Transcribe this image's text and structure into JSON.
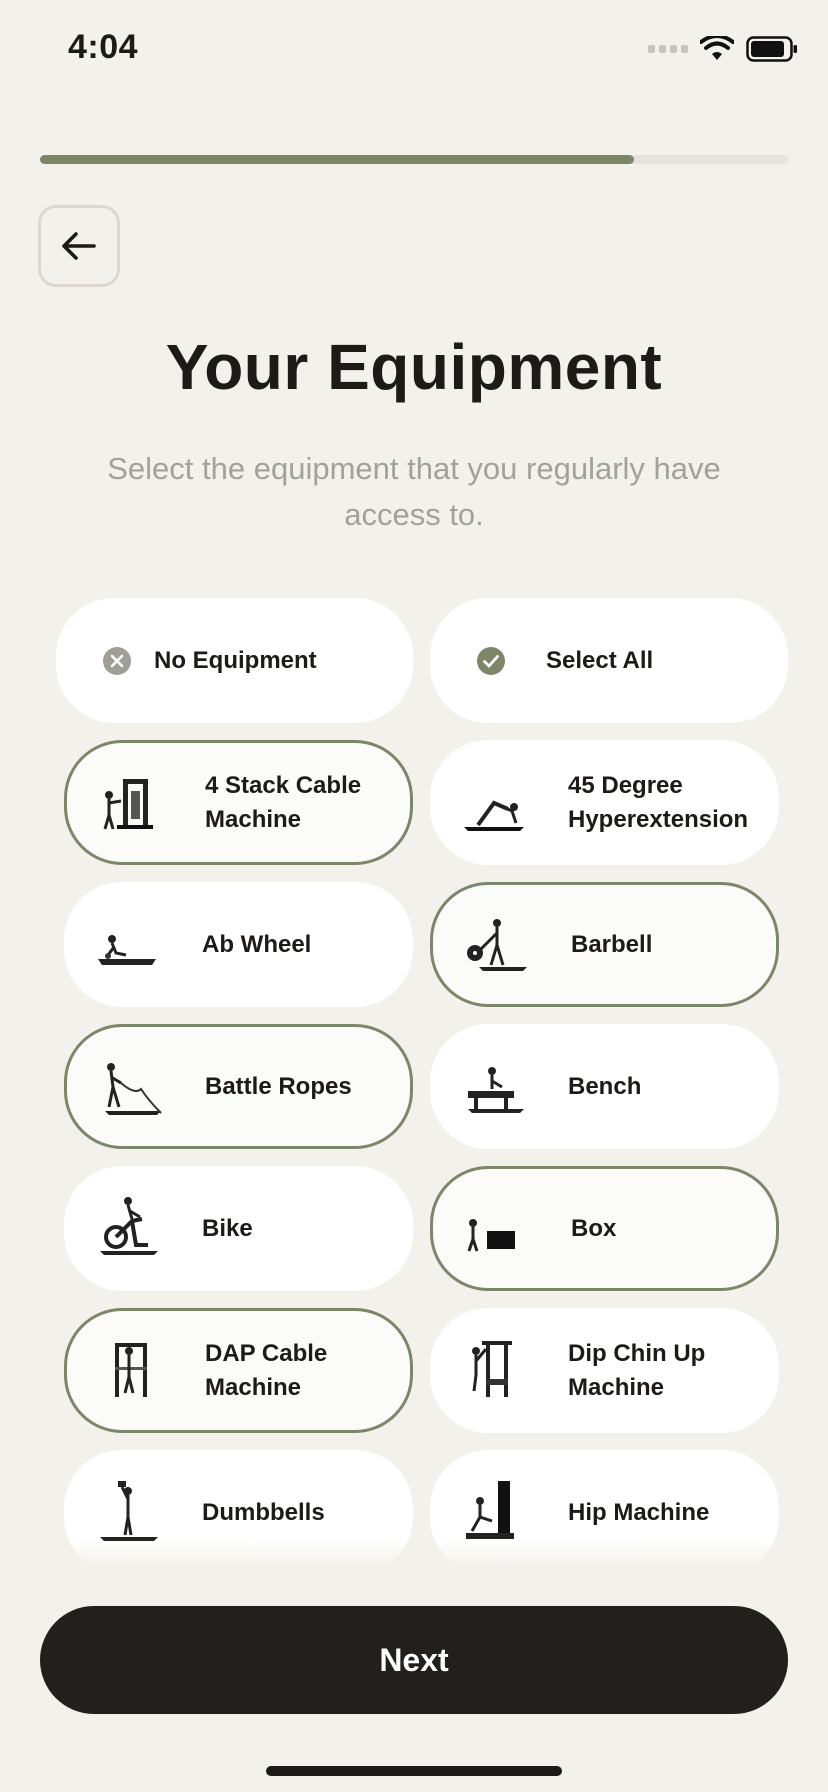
{
  "status_bar": {
    "time": "4:04"
  },
  "progress": {
    "fraction": 0.794
  },
  "page": {
    "title": "Your Equipment",
    "subtitle": "Select the equipment that you regularly have access to."
  },
  "quick_options": [
    {
      "label": "No Equipment",
      "icon": "x-circle-icon"
    },
    {
      "label": "Select All",
      "icon": "check-circle-icon"
    }
  ],
  "equipment": [
    {
      "label": "4 Stack Cable Machine",
      "selected": true,
      "icon": "cable-machine-icon"
    },
    {
      "label": "45 Degree Hyperextension",
      "selected": false,
      "icon": "hyperextension-icon"
    },
    {
      "label": "Ab Wheel",
      "selected": false,
      "icon": "ab-wheel-icon"
    },
    {
      "label": "Barbell",
      "selected": true,
      "icon": "barbell-icon"
    },
    {
      "label": "Battle Ropes",
      "selected": true,
      "icon": "battle-ropes-icon"
    },
    {
      "label": "Bench",
      "selected": false,
      "icon": "bench-icon"
    },
    {
      "label": "Bike",
      "selected": false,
      "icon": "bike-icon"
    },
    {
      "label": "Box",
      "selected": true,
      "icon": "box-icon"
    },
    {
      "label": "DAP Cable Machine",
      "selected": true,
      "icon": "dap-cable-machine-icon"
    },
    {
      "label": "Dip Chin Up Machine",
      "selected": false,
      "icon": "dip-chin-up-icon"
    },
    {
      "label": "Dumbbells",
      "selected": false,
      "icon": "dumbbells-icon"
    },
    {
      "label": "Hip Machine",
      "selected": false,
      "icon": "hip-machine-icon"
    }
  ],
  "footer": {
    "next_label": "Next"
  },
  "colors": {
    "accent": "#7c8669",
    "background": "#f3f1eb",
    "button": "#231f1c"
  }
}
